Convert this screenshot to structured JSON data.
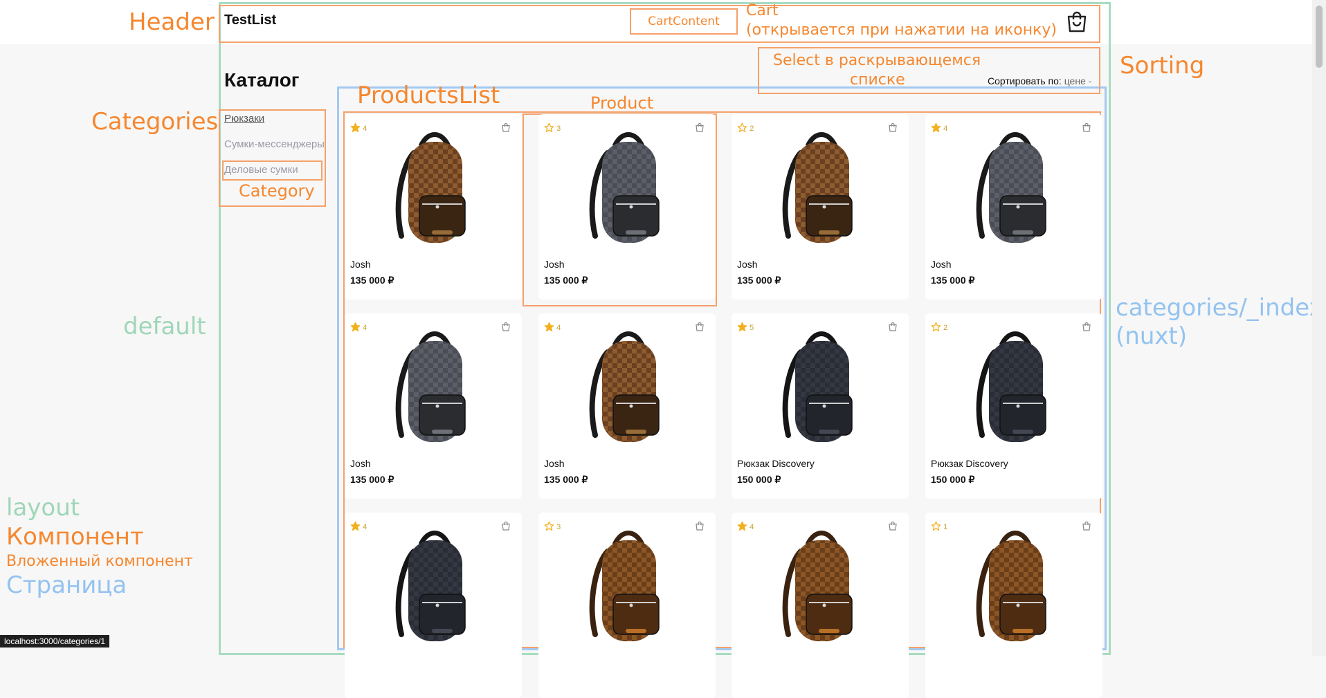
{
  "header": {
    "logo": "TestList",
    "cart_content_label": "CartContent"
  },
  "page": {
    "title": "Каталог",
    "sort_label": "Сортировать по:",
    "sort_value": "цене"
  },
  "categories": [
    {
      "label": "Рюкзаки",
      "active": true
    },
    {
      "label": "Сумки-мессенджеры",
      "active": false
    },
    {
      "label": "Деловые сумки",
      "active": false
    }
  ],
  "products": [
    {
      "name": "Josh",
      "price": "135 000 ₽",
      "rating": "4",
      "style": "brown-mono"
    },
    {
      "name": "Josh",
      "price": "135 000 ₽",
      "rating": "3",
      "style": "grey-check"
    },
    {
      "name": "Josh",
      "price": "135 000 ₽",
      "rating": "2",
      "style": "brown-mono"
    },
    {
      "name": "Josh",
      "price": "135 000 ₽",
      "rating": "4",
      "style": "grey-check"
    },
    {
      "name": "Josh",
      "price": "135 000 ₽",
      "rating": "4",
      "style": "grey-check"
    },
    {
      "name": "Josh",
      "price": "135 000 ₽",
      "rating": "4",
      "style": "brown-mono"
    },
    {
      "name": "Рюкзак Discovery",
      "price": "150 000 ₽",
      "rating": "5",
      "style": "dark-mono"
    },
    {
      "name": "Рюкзак Discovery",
      "price": "150 000 ₽",
      "rating": "2",
      "style": "dark-mono"
    },
    {
      "name": "",
      "price": "",
      "rating": "4",
      "style": "dark-mono"
    },
    {
      "name": "",
      "price": "",
      "rating": "3",
      "style": "orange-check"
    },
    {
      "name": "",
      "price": "",
      "rating": "4",
      "style": "orange-check"
    },
    {
      "name": "",
      "price": "",
      "rating": "1",
      "style": "orange-check"
    }
  ],
  "annotations": {
    "header": "Header",
    "cart": "Cart",
    "cart_note": "(открывается при нажатии на иконку)",
    "select_note_1": "Select в раскрывающемся",
    "select_note_2": "списке",
    "sorting": "Sorting",
    "products_list": "ProductsList",
    "product": "Product",
    "categories": "Categories",
    "category": "Category",
    "default": "default",
    "page_name_1": "categories/_index",
    "page_name_2": "(nuxt)",
    "legend_layout": "layout",
    "legend_component": "Компонент",
    "legend_nested": "Вложенный компонент",
    "legend_page": "Страница"
  },
  "status_bar": "localhost:3000/categories/1",
  "colors": {
    "component": "#f5872f",
    "layout": "#9fd6b8",
    "page": "#93c3f0",
    "star": "#f2b01e"
  }
}
